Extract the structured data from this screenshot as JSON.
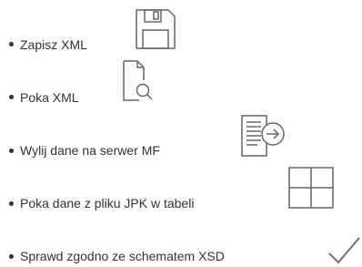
{
  "list": {
    "items": [
      {
        "label": "Zapisz XML",
        "icon": "floppy-disk-icon"
      },
      {
        "label": "Poka XML",
        "icon": "document-search-icon"
      },
      {
        "label": "Wylij dane na serwer MF",
        "icon": "document-send-icon"
      },
      {
        "label": "Poka dane z pliku JPK w tabeli",
        "icon": "table-grid-icon"
      },
      {
        "label": "Sprawd zgodno ze schematem XSD",
        "icon": "checkmark-icon"
      }
    ]
  },
  "colors": {
    "text": "#333333",
    "icon_stroke": "#666666"
  }
}
